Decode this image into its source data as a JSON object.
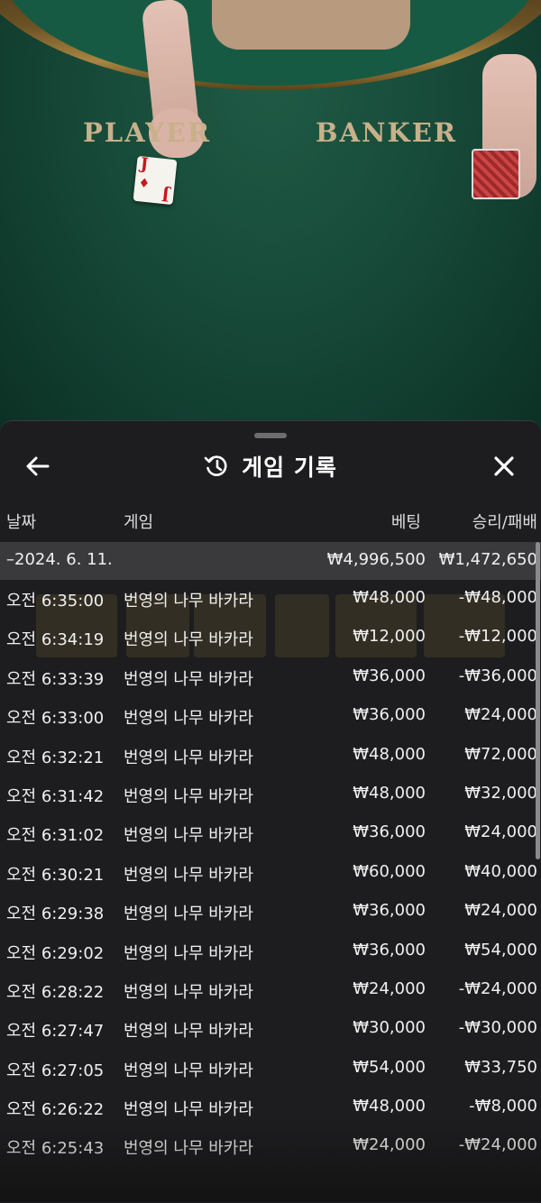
{
  "table": {
    "player_label": "PLAYER",
    "banker_label": "BANKER",
    "card_rank": "J",
    "card_suit": "♦"
  },
  "sheet": {
    "title": "게임 기록",
    "back_icon": "arrow-left-icon",
    "history_icon": "history-icon",
    "close_icon": "close-icon"
  },
  "columns": {
    "date": "날짜",
    "game": "게임",
    "bet": "베팅",
    "result": "승리/패배"
  },
  "summary": {
    "date": "–2024. 6. 11.",
    "bet": "₩4,996,500",
    "result": "₩1,472,650"
  },
  "rows": [
    {
      "time": "오전 6:35:00",
      "game": "번영의 나무 바카라",
      "bet": "₩48,000",
      "result": "-₩48,000"
    },
    {
      "time": "오전 6:34:19",
      "game": "번영의 나무 바카라",
      "bet": "₩12,000",
      "result": "-₩12,000"
    },
    {
      "time": "오전 6:33:39",
      "game": "번영의 나무 바카라",
      "bet": "₩36,000",
      "result": "-₩36,000"
    },
    {
      "time": "오전 6:33:00",
      "game": "번영의 나무 바카라",
      "bet": "₩36,000",
      "result": "₩24,000"
    },
    {
      "time": "오전 6:32:21",
      "game": "번영의 나무 바카라",
      "bet": "₩48,000",
      "result": "₩72,000"
    },
    {
      "time": "오전 6:31:42",
      "game": "번영의 나무 바카라",
      "bet": "₩48,000",
      "result": "₩32,000"
    },
    {
      "time": "오전 6:31:02",
      "game": "번영의 나무 바카라",
      "bet": "₩36,000",
      "result": "₩24,000"
    },
    {
      "time": "오전 6:30:21",
      "game": "번영의 나무 바카라",
      "bet": "₩60,000",
      "result": "₩40,000"
    },
    {
      "time": "오전 6:29:38",
      "game": "번영의 나무 바카라",
      "bet": "₩36,000",
      "result": "₩24,000"
    },
    {
      "time": "오전 6:29:02",
      "game": "번영의 나무 바카라",
      "bet": "₩36,000",
      "result": "₩54,000"
    },
    {
      "time": "오전 6:28:22",
      "game": "번영의 나무 바카라",
      "bet": "₩24,000",
      "result": "-₩24,000"
    },
    {
      "time": "오전 6:27:47",
      "game": "번영의 나무 바카라",
      "bet": "₩30,000",
      "result": "-₩30,000"
    },
    {
      "time": "오전 6:27:05",
      "game": "번영의 나무 바카라",
      "bet": "₩54,000",
      "result": "₩33,750"
    },
    {
      "time": "오전 6:26:22",
      "game": "번영의 나무 바카라",
      "bet": "₩48,000",
      "result": "-₩8,000"
    },
    {
      "time": "오전 6:25:43",
      "game": "번영의 나무 바카라",
      "bet": "₩24,000",
      "result": "-₩24,000"
    }
  ]
}
